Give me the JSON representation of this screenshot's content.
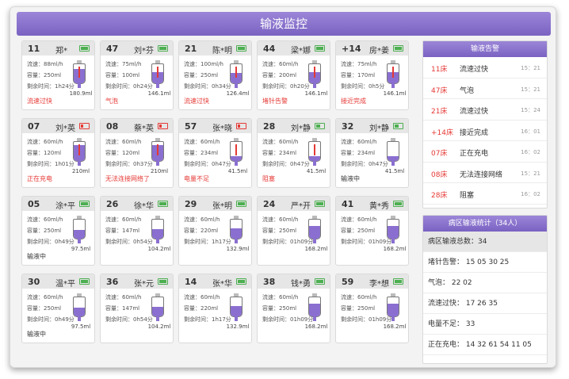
{
  "title": "输液监控",
  "labels": {
    "rate": "流速：",
    "volume": "容量：",
    "remaining": "剩余时间："
  },
  "cards": [
    {
      "bed": "11",
      "name": "郑*",
      "rate": "88ml/h",
      "vol": "250ml",
      "time": "1h24分",
      "bag": "180.9ml",
      "level": 0.75,
      "alarm": true,
      "battery": "full",
      "status": "流速过快",
      "red": true
    },
    {
      "bed": "47",
      "name": "刘*芬",
      "rate": "75ml/h",
      "vol": "100ml",
      "time": "0h24分",
      "bag": "146.1ml",
      "level": 0.6,
      "alarm": true,
      "battery": "full",
      "status": "气泡",
      "red": true
    },
    {
      "bed": "21",
      "name": "陈*明",
      "rate": "100ml/h",
      "vol": "250ml",
      "time": "0h34分",
      "bag": "126.4ml",
      "level": 0.55,
      "alarm": true,
      "battery": "full",
      "status": "流速过快",
      "red": true
    },
    {
      "bed": "44",
      "name": "梁*娜",
      "rate": "60ml/h",
      "vol": "200ml",
      "time": "0h20分",
      "bag": "146.1ml",
      "level": 0.6,
      "alarm": true,
      "battery": "full",
      "status": "堵针告警",
      "red": true
    },
    {
      "bed": "+14",
      "name": "房*姜",
      "rate": "75ml/h",
      "vol": "170ml",
      "time": "0h5分",
      "bag": "146.1ml",
      "level": 0.6,
      "alarm": true,
      "battery": "full",
      "status": "接近完成",
      "red": true
    },
    {
      "bed": "07",
      "name": "刘*英",
      "rate": "60ml/h",
      "vol": "120ml",
      "time": "1h01分",
      "bag": "210ml",
      "level": 0.85,
      "alarm": true,
      "battery": "low",
      "status": "正在充电",
      "red": true
    },
    {
      "bed": "08",
      "name": "蔡*英",
      "rate": "60ml/h",
      "vol": "120ml",
      "time": "0h37分",
      "bag": "210ml",
      "level": 0.85,
      "alarm": true,
      "battery": "low",
      "status": "无法连接网络了",
      "red": true
    },
    {
      "bed": "57",
      "name": "张*晓",
      "rate": "60ml/h",
      "vol": "234ml",
      "time": "0h47分",
      "bag": "41.5ml",
      "level": 0.25,
      "alarm": true,
      "battery": "low",
      "status": "电量不足",
      "red": true
    },
    {
      "bed": "28",
      "name": "刘*静",
      "rate": "60ml/h",
      "vol": "234ml",
      "time": "0h47分",
      "bag": "41.5ml",
      "level": 0.25,
      "alarm": true,
      "battery": "mid",
      "status": "阻塞",
      "red": true
    },
    {
      "bed": "32",
      "name": "刘*静",
      "rate": "60ml/h",
      "vol": "234ml",
      "time": "0h47分",
      "bag": "41.5ml",
      "level": 0.25,
      "alarm": false,
      "battery": "mid",
      "status": "输液中",
      "red": false
    },
    {
      "bed": "05",
      "name": "涂*平",
      "rate": "60ml/h",
      "vol": "250ml",
      "time": "0h49分",
      "bag": "97.5ml",
      "level": 0.45,
      "alarm": false,
      "battery": "full",
      "status": "输液中",
      "red": false
    },
    {
      "bed": "26",
      "name": "徐*华",
      "rate": "60ml/h",
      "vol": "147ml",
      "time": "0h54分",
      "bag": "104.2ml",
      "level": 0.48,
      "alarm": false,
      "battery": "full",
      "status": "",
      "red": false
    },
    {
      "bed": "29",
      "name": "张*明",
      "rate": "60ml/h",
      "vol": "220ml",
      "time": "1h17分",
      "bag": "132.9ml",
      "level": 0.55,
      "alarm": false,
      "battery": "full",
      "status": "",
      "red": false
    },
    {
      "bed": "24",
      "name": "严*开",
      "rate": "60ml/h",
      "vol": "250ml",
      "time": "01h09分",
      "bag": "168.2ml",
      "level": 0.65,
      "alarm": false,
      "battery": "full",
      "status": "",
      "red": false
    },
    {
      "bed": "41",
      "name": "黄*秀",
      "rate": "60ml/h",
      "vol": "250ml",
      "time": "01h09分",
      "bag": "168.2ml",
      "level": 0.65,
      "alarm": false,
      "battery": "full",
      "status": "",
      "red": false
    },
    {
      "bed": "30",
      "name": "温*平",
      "rate": "60ml/h",
      "vol": "250ml",
      "time": "0h49分",
      "bag": "97.5ml",
      "level": 0.45,
      "alarm": false,
      "battery": "full",
      "status": "输液中",
      "red": false
    },
    {
      "bed": "36",
      "name": "张*元",
      "rate": "60ml/h",
      "vol": "147ml",
      "time": "0h54分",
      "bag": "104.2ml",
      "level": 0.48,
      "alarm": false,
      "battery": "full",
      "status": "",
      "red": false
    },
    {
      "bed": "14",
      "name": "张*华",
      "rate": "60ml/h",
      "vol": "220ml",
      "time": "1h17分",
      "bag": "132.9ml",
      "level": 0.55,
      "alarm": false,
      "battery": "full",
      "status": "",
      "red": false
    },
    {
      "bed": "38",
      "name": "钱*勇",
      "rate": "60ml/h",
      "vol": "250ml",
      "time": "01h09分",
      "bag": "168.2ml",
      "level": 0.65,
      "alarm": false,
      "battery": "full",
      "status": "",
      "red": false
    },
    {
      "bed": "59",
      "name": "李*想",
      "rate": "60ml/h",
      "vol": "250ml",
      "time": "01h09分",
      "bag": "168.2ml",
      "level": 0.65,
      "alarm": false,
      "battery": "full",
      "status": "",
      "red": false
    }
  ],
  "alerts": {
    "title": "输液告警",
    "items": [
      {
        "bed": "11床",
        "msg": "流速过快",
        "time": "15：21"
      },
      {
        "bed": "47床",
        "msg": "气泡",
        "time": "15：21"
      },
      {
        "bed": "21床",
        "msg": "流速过快",
        "time": "15：24"
      },
      {
        "bed": "+14床",
        "msg": "接近完成",
        "time": "16：01"
      },
      {
        "bed": "07床",
        "msg": "正在充电",
        "time": "16：02"
      },
      {
        "bed": "08床",
        "msg": "无法连接网络",
        "time": "15：21"
      },
      {
        "bed": "28床",
        "msg": "阻塞",
        "time": "16：02"
      }
    ]
  },
  "stats": {
    "title": "病区输液统计（34人）",
    "rows": [
      "病区输液总数：34",
      "堵针告警：  15   05   30   25",
      "气泡：  22   02",
      "流速过快：  17   26   35",
      "电量不足：  33",
      "正在充电：  14   32   61   54   11   05"
    ]
  },
  "colors": {
    "accent": "#8a6fd0",
    "alarm": "#e53935",
    "ok": "#4caf50"
  }
}
